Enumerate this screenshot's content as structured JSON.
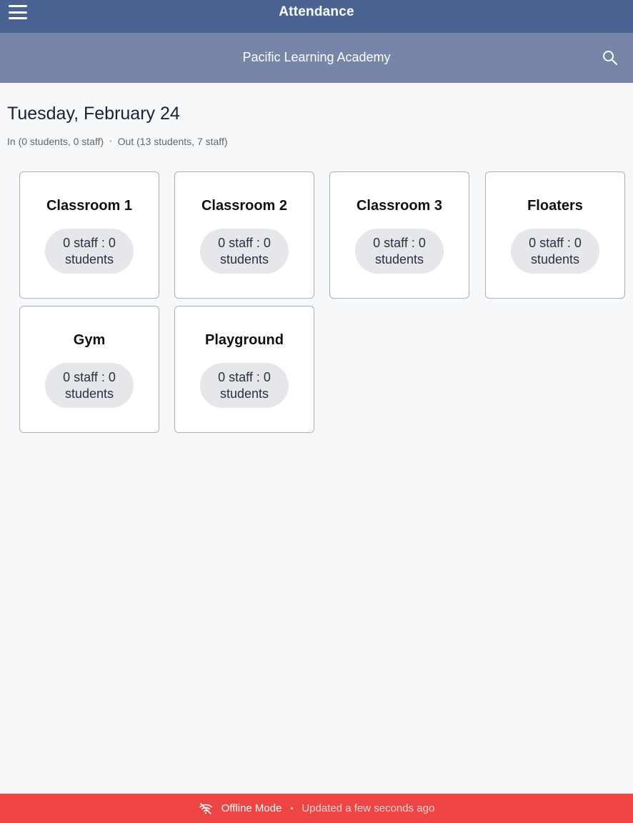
{
  "header": {
    "title": "Attendance",
    "menu_icon": "hamburger-menu-icon"
  },
  "subheader": {
    "school_name": "Pacific Learning Academy",
    "search_icon": "search-icon"
  },
  "date": "Tuesday, February 24",
  "summary": {
    "in_text": "In (0 students, 0 staff)",
    "separator": "•",
    "out_text": "Out (13 students, 7 staff)"
  },
  "rooms": [
    {
      "name": "Classroom 1",
      "count_line1": "0 staff : 0",
      "count_line2": "students"
    },
    {
      "name": "Classroom 2",
      "count_line1": "0 staff : 0",
      "count_line2": "students"
    },
    {
      "name": "Classroom 3",
      "count_line1": "0 staff : 0",
      "count_line2": "students"
    },
    {
      "name": "Floaters",
      "count_line1": "0 staff : 0",
      "count_line2": "students"
    },
    {
      "name": "Gym",
      "count_line1": "0 staff : 0",
      "count_line2": "students"
    },
    {
      "name": "Playground",
      "count_line1": "0 staff : 0",
      "count_line2": "students"
    }
  ],
  "status": {
    "icon": "wifi-off-icon",
    "mode": "Offline Mode",
    "separator": "•",
    "updated": "Updated a few seconds ago"
  },
  "colors": {
    "header_bg": "#4b6392",
    "subheader_bg": "#7685a8",
    "status_bg": "#ef4444",
    "pill_bg": "#e5e7eb"
  }
}
